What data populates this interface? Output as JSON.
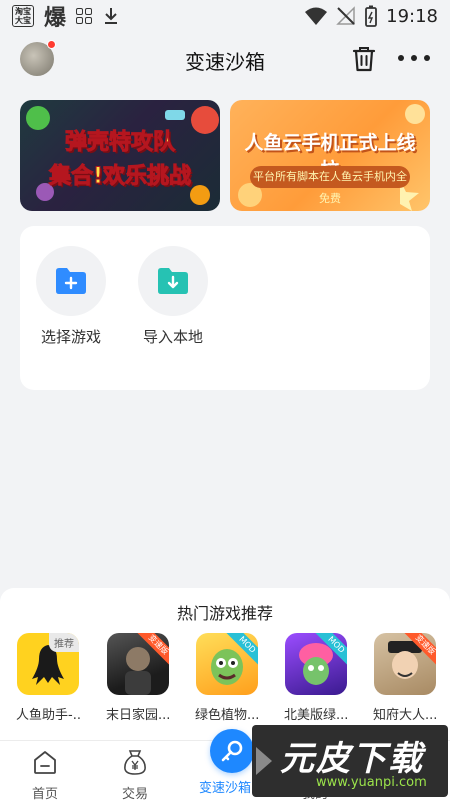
{
  "status_bar": {
    "badge_text": "淘宝大宝",
    "bao_text": "爆",
    "time": "19:18"
  },
  "header": {
    "title": "变速沙箱"
  },
  "banners": [
    {
      "line1": "弹壳特攻队",
      "line2": "集合!欢乐挑战"
    },
    {
      "title": "人鱼云手机正式上线拉",
      "subtitle": "平台所有脚本在人鱼云手机内全免费"
    }
  ],
  "actions": [
    {
      "label": "选择游戏",
      "icon": "folder-plus-icon",
      "color": "#2f8cff"
    },
    {
      "label": "导入本地",
      "icon": "folder-download-icon",
      "color": "#26c2b3"
    }
  ],
  "hot_games": {
    "title": "热门游戏推荐",
    "items": [
      {
        "name": "人鱼助手-...",
        "tag": "推荐"
      },
      {
        "name": "末日家园...",
        "tag": "变速版"
      },
      {
        "name": "绿色植物...",
        "tag": "MOD"
      },
      {
        "name": "北美版绿...",
        "tag": "MOD"
      },
      {
        "name": "知府大人...",
        "tag": "变速版"
      }
    ]
  },
  "nav": {
    "items": [
      {
        "label": "首页"
      },
      {
        "label": "交易"
      },
      {
        "label": "变速沙箱"
      },
      {
        "label": "我的"
      }
    ]
  },
  "watermark": {
    "main": "元皮下载",
    "sub": "www.yuanpi.com"
  },
  "colors": {
    "accent": "#1e88ff",
    "background": "#f2f3f5"
  }
}
